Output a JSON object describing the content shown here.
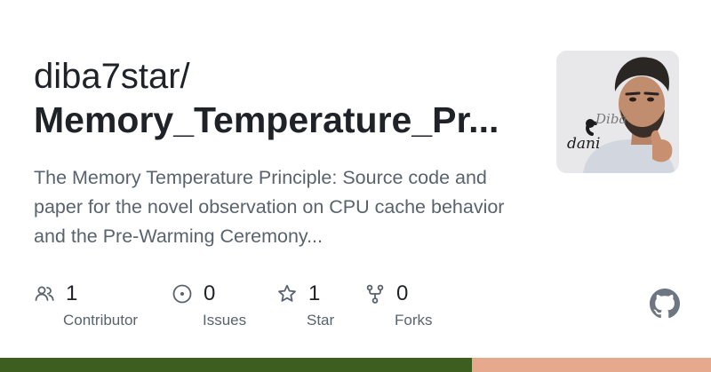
{
  "repo": {
    "owner": "diba7star/",
    "name": "Memory_Temperature_Pr...",
    "description": "The Memory Temperature Principle: Source code and paper for the novel observation on CPU cache behavior and the Pre-Warming Ceremony..."
  },
  "avatar": {
    "logo_text_top": "Diba",
    "logo_text_bottom": "dani"
  },
  "stats": {
    "contributors": {
      "count": "1",
      "label": "Contributor",
      "icon": "people-icon"
    },
    "issues": {
      "count": "0",
      "label": "Issues",
      "icon": "issue-opened-icon"
    },
    "stars": {
      "count": "1",
      "label": "Star",
      "icon": "star-icon"
    },
    "forks": {
      "count": "0",
      "label": "Forks",
      "icon": "repo-forked-icon"
    }
  },
  "language_bar": {
    "colors": [
      "#3d5e1f",
      "#e7a98d"
    ]
  },
  "colors": {
    "text_primary": "#1f2328",
    "text_secondary": "#59636e",
    "icon": "#59636e",
    "github_logo": "#6e7681"
  }
}
